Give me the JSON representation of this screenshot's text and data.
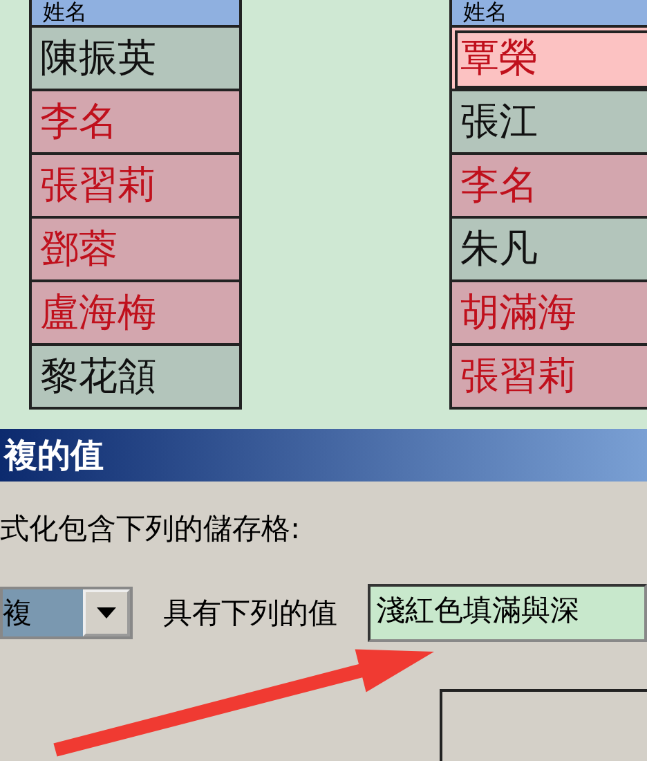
{
  "sheet": {
    "columns": [
      {
        "header": "姓名",
        "cells": [
          {
            "text": "陳振英",
            "highlighted": false,
            "selected": false
          },
          {
            "text": "李名",
            "highlighted": true,
            "selected": false
          },
          {
            "text": "張習莉",
            "highlighted": true,
            "selected": false
          },
          {
            "text": "鄧蓉",
            "highlighted": true,
            "selected": false
          },
          {
            "text": "盧海梅",
            "highlighted": true,
            "selected": false
          },
          {
            "text": "黎花頷",
            "highlighted": false,
            "selected": false
          }
        ]
      },
      {
        "header": "姓名",
        "cells": [
          {
            "text": "覃榮",
            "highlighted": true,
            "selected": true
          },
          {
            "text": "張江",
            "highlighted": false,
            "selected": false
          },
          {
            "text": "李名",
            "highlighted": true,
            "selected": false
          },
          {
            "text": "朱凡",
            "highlighted": false,
            "selected": false
          },
          {
            "text": "胡滿海",
            "highlighted": true,
            "selected": false
          },
          {
            "text": "張習莉",
            "highlighted": true,
            "selected": false
          }
        ]
      }
    ]
  },
  "dialog": {
    "title": "複的值",
    "instruction": "式化包含下列的儲存格:",
    "type_select": {
      "value": "複"
    },
    "values_label": "具有下列的值",
    "format_select": {
      "value": "淺紅色填滿與深"
    }
  }
}
